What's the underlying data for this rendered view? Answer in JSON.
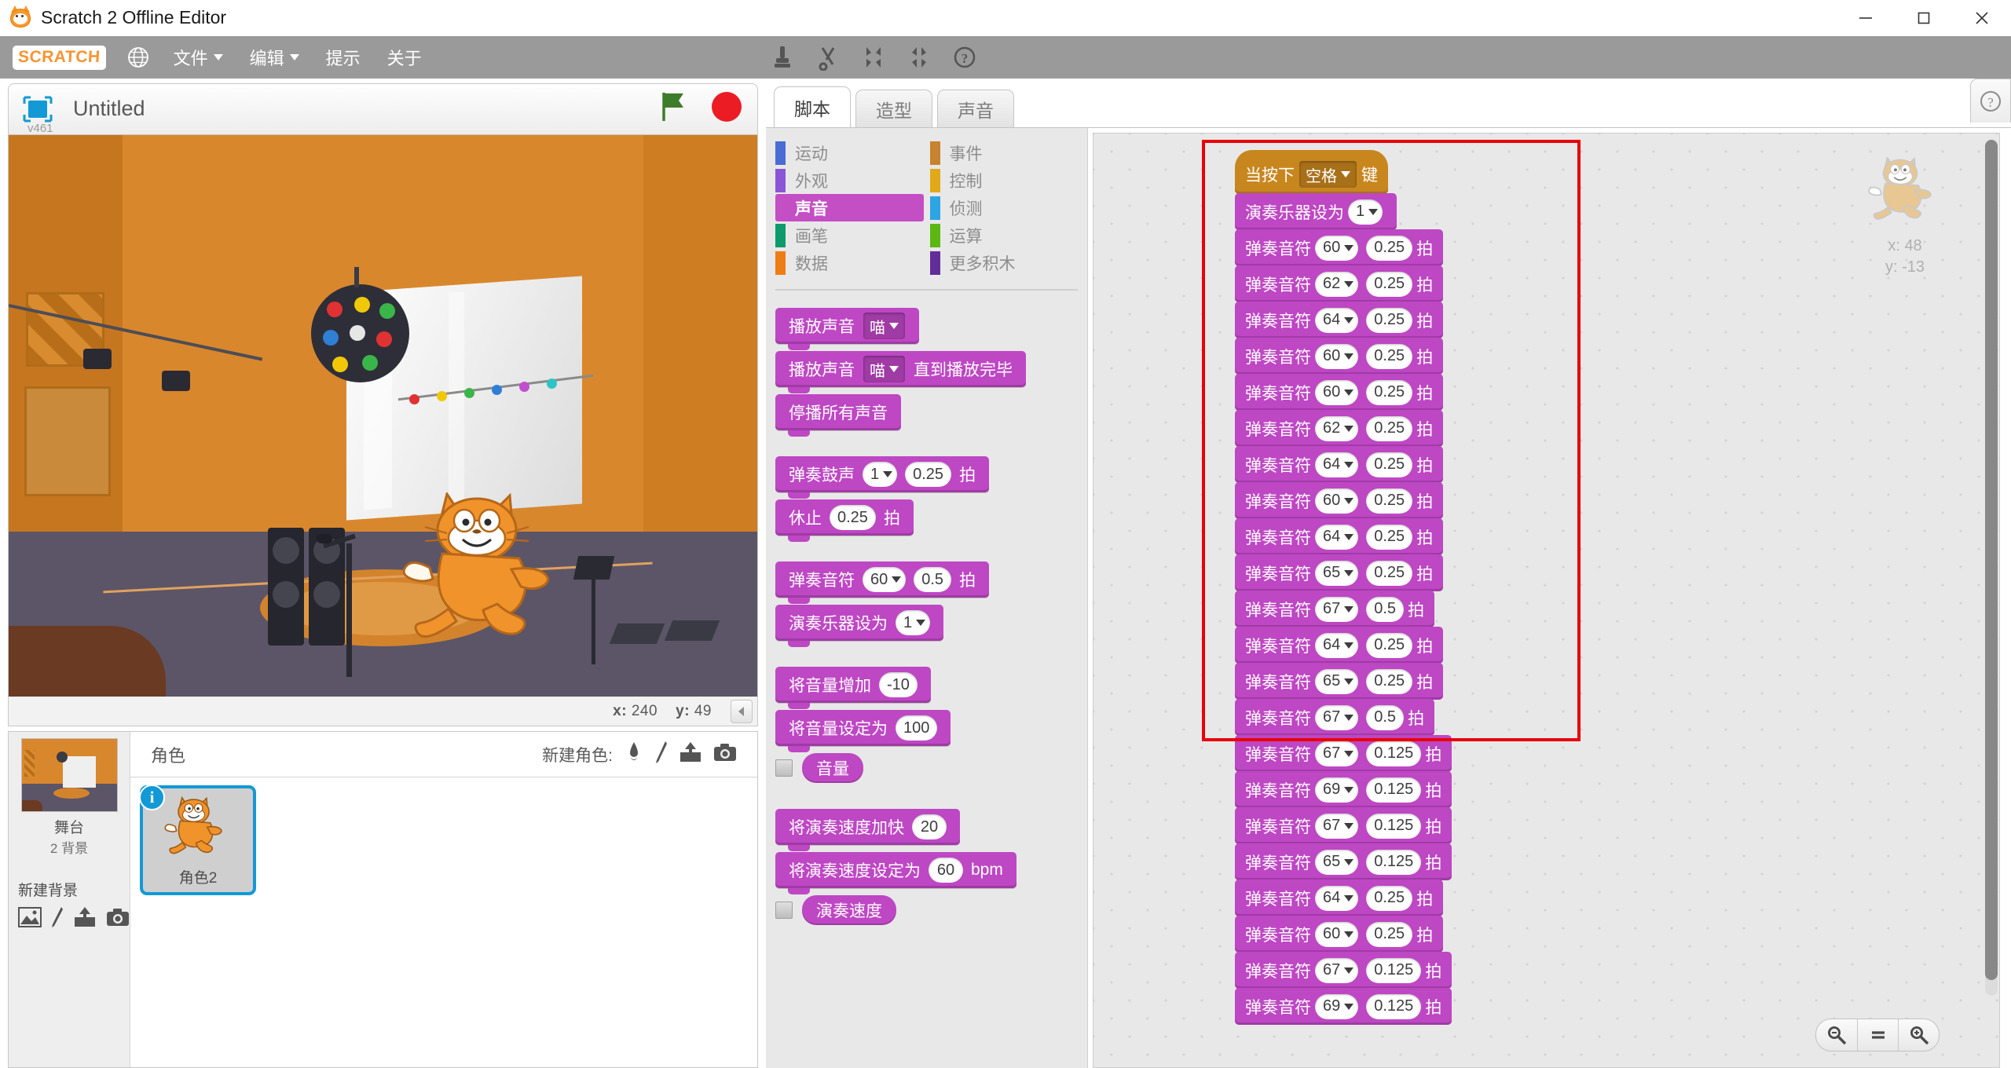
{
  "window": {
    "title": "Scratch 2 Offline Editor",
    "icon": "scratch-cat-icon",
    "minimize": "minimize-icon",
    "maximize": "maximize-icon",
    "close": "close-icon"
  },
  "menubar": {
    "logo": "SCRATCH",
    "globe_icon": "globe-icon",
    "items": [
      {
        "label": "文件",
        "has_caret": true
      },
      {
        "label": "编辑",
        "has_caret": true
      },
      {
        "label": "提示",
        "has_caret": false
      },
      {
        "label": "关于",
        "has_caret": false
      }
    ],
    "tools": [
      {
        "name": "stamp-tool-icon"
      },
      {
        "name": "scissors-tool-icon"
      },
      {
        "name": "grow-tool-icon"
      },
      {
        "name": "shrink-tool-icon"
      },
      {
        "name": "help-tool-icon"
      }
    ]
  },
  "stage": {
    "project_title": "Untitled",
    "version": "v461",
    "present_icon": "fullscreen-icon",
    "green_flag": "green-flag-icon",
    "stop_button": "stop-icon",
    "mouse_x_label": "x:",
    "mouse_x": "240",
    "mouse_y_label": "y:",
    "mouse_y": "49",
    "collapse_icon": "collapse-left-icon"
  },
  "stage_panel": {
    "thumb_label": "舞台",
    "backdrop_count": "2 背景",
    "new_backdrop_label": "新建背景",
    "new_backdrop_icons": [
      "library-icon",
      "paint-icon",
      "upload-icon",
      "camera-icon"
    ]
  },
  "sprite_panel": {
    "header": "角色",
    "new_sprite_label": "新建角色:",
    "new_sprite_icons": [
      "library-icon",
      "paint-icon",
      "upload-icon",
      "camera-icon"
    ],
    "sprites": [
      {
        "name": "角色2",
        "selected": true,
        "info_badge": "i"
      }
    ]
  },
  "tabs": [
    {
      "label": "脚本",
      "active": true
    },
    {
      "label": "造型",
      "active": false
    },
    {
      "label": "声音",
      "active": false
    }
  ],
  "palette": {
    "categories": [
      {
        "label": "运动",
        "color": "#4a6cd4",
        "selected": false
      },
      {
        "label": "事件",
        "color": "#c88330",
        "selected": false
      },
      {
        "label": "外观",
        "color": "#8a55d7",
        "selected": false
      },
      {
        "label": "控制",
        "color": "#e1a91a",
        "selected": false
      },
      {
        "label": "声音",
        "color": "#bb42c3",
        "selected": true
      },
      {
        "label": "侦测",
        "color": "#2ca5e2",
        "selected": false
      },
      {
        "label": "画笔",
        "color": "#0e9a6c",
        "selected": false
      },
      {
        "label": "运算",
        "color": "#5cb712",
        "selected": false
      },
      {
        "label": "数据",
        "color": "#ee7d16",
        "selected": false
      },
      {
        "label": "更多积木",
        "color": "#632d99",
        "selected": false
      }
    ],
    "blocks": [
      {
        "id": "play-sound",
        "parts": [
          {
            "t": "label",
            "v": "播放声音"
          },
          {
            "t": "inset-drop",
            "v": "喵"
          }
        ]
      },
      {
        "id": "play-sound-until-done",
        "parts": [
          {
            "t": "label",
            "v": "播放声音"
          },
          {
            "t": "inset-drop",
            "v": "喵"
          },
          {
            "t": "label",
            "v": "直到播放完毕"
          }
        ]
      },
      {
        "id": "stop-all-sounds",
        "parts": [
          {
            "t": "label",
            "v": "停播所有声音"
          }
        ]
      },
      {
        "id": "gap"
      },
      {
        "id": "play-drum",
        "parts": [
          {
            "t": "label",
            "v": "弹奏鼓声"
          },
          {
            "t": "oval-drop",
            "v": "1"
          },
          {
            "t": "oval",
            "v": "0.25"
          },
          {
            "t": "label",
            "v": "拍"
          }
        ]
      },
      {
        "id": "rest-for",
        "parts": [
          {
            "t": "label",
            "v": "休止"
          },
          {
            "t": "oval",
            "v": "0.25"
          },
          {
            "t": "label",
            "v": "拍"
          }
        ]
      },
      {
        "id": "gap"
      },
      {
        "id": "play-note",
        "parts": [
          {
            "t": "label",
            "v": "弹奏音符"
          },
          {
            "t": "oval-drop",
            "v": "60"
          },
          {
            "t": "oval",
            "v": "0.5"
          },
          {
            "t": "label",
            "v": "拍"
          }
        ]
      },
      {
        "id": "set-instrument",
        "parts": [
          {
            "t": "label",
            "v": "演奏乐器设为"
          },
          {
            "t": "oval-drop",
            "v": "1"
          }
        ]
      },
      {
        "id": "gap"
      },
      {
        "id": "change-volume",
        "parts": [
          {
            "t": "label",
            "v": "将音量增加"
          },
          {
            "t": "oval",
            "v": "-10"
          }
        ]
      },
      {
        "id": "set-volume",
        "parts": [
          {
            "t": "label",
            "v": "将音量设定为"
          },
          {
            "t": "oval",
            "v": "100"
          }
        ]
      },
      {
        "id": "volume-reporter",
        "reporter": true,
        "checkbox": true,
        "parts": [
          {
            "t": "label",
            "v": "音量"
          }
        ]
      },
      {
        "id": "gap"
      },
      {
        "id": "change-tempo",
        "parts": [
          {
            "t": "label",
            "v": "将演奏速度加快"
          },
          {
            "t": "oval",
            "v": "20"
          }
        ]
      },
      {
        "id": "set-tempo",
        "parts": [
          {
            "t": "label",
            "v": "将演奏速度设定为"
          },
          {
            "t": "oval",
            "v": "60"
          },
          {
            "t": "label",
            "v": "bpm"
          }
        ]
      },
      {
        "id": "tempo-reporter",
        "reporter": true,
        "checkbox": true,
        "parts": [
          {
            "t": "label",
            "v": "演奏速度"
          }
        ]
      }
    ]
  },
  "script": {
    "sprite_watermark": {
      "x_label": "x:",
      "x": "48",
      "y_label": "y:",
      "y": "-13"
    },
    "highlight_color": "#e8000a",
    "zoom_controls": [
      "zoom-out-icon",
      "zoom-reset-icon",
      "zoom-in-icon"
    ],
    "help_icon": "help-icon",
    "blocks": [
      {
        "kind": "hat",
        "parts": [
          {
            "t": "label",
            "v": "当按下"
          },
          {
            "t": "inset-drop",
            "v": "空格"
          },
          {
            "t": "label",
            "v": "键"
          }
        ]
      },
      {
        "kind": "stack",
        "parts": [
          {
            "t": "label",
            "v": "演奏乐器设为"
          },
          {
            "t": "oval-drop",
            "v": "1"
          }
        ]
      },
      {
        "kind": "stack",
        "parts": [
          {
            "t": "label",
            "v": "弹奏音符"
          },
          {
            "t": "oval-drop",
            "v": "60"
          },
          {
            "t": "oval",
            "v": "0.25"
          },
          {
            "t": "label",
            "v": "拍"
          }
        ]
      },
      {
        "kind": "stack",
        "parts": [
          {
            "t": "label",
            "v": "弹奏音符"
          },
          {
            "t": "oval-drop",
            "v": "62"
          },
          {
            "t": "oval",
            "v": "0.25"
          },
          {
            "t": "label",
            "v": "拍"
          }
        ]
      },
      {
        "kind": "stack",
        "parts": [
          {
            "t": "label",
            "v": "弹奏音符"
          },
          {
            "t": "oval-drop",
            "v": "64"
          },
          {
            "t": "oval",
            "v": "0.25"
          },
          {
            "t": "label",
            "v": "拍"
          }
        ]
      },
      {
        "kind": "stack",
        "parts": [
          {
            "t": "label",
            "v": "弹奏音符"
          },
          {
            "t": "oval-drop",
            "v": "60"
          },
          {
            "t": "oval",
            "v": "0.25"
          },
          {
            "t": "label",
            "v": "拍"
          }
        ]
      },
      {
        "kind": "stack",
        "parts": [
          {
            "t": "label",
            "v": "弹奏音符"
          },
          {
            "t": "oval-drop",
            "v": "60"
          },
          {
            "t": "oval",
            "v": "0.25"
          },
          {
            "t": "label",
            "v": "拍"
          }
        ]
      },
      {
        "kind": "stack",
        "parts": [
          {
            "t": "label",
            "v": "弹奏音符"
          },
          {
            "t": "oval-drop",
            "v": "62"
          },
          {
            "t": "oval",
            "v": "0.25"
          },
          {
            "t": "label",
            "v": "拍"
          }
        ]
      },
      {
        "kind": "stack",
        "parts": [
          {
            "t": "label",
            "v": "弹奏音符"
          },
          {
            "t": "oval-drop",
            "v": "64"
          },
          {
            "t": "oval",
            "v": "0.25"
          },
          {
            "t": "label",
            "v": "拍"
          }
        ]
      },
      {
        "kind": "stack",
        "parts": [
          {
            "t": "label",
            "v": "弹奏音符"
          },
          {
            "t": "oval-drop",
            "v": "60"
          },
          {
            "t": "oval",
            "v": "0.25"
          },
          {
            "t": "label",
            "v": "拍"
          }
        ]
      },
      {
        "kind": "stack",
        "parts": [
          {
            "t": "label",
            "v": "弹奏音符"
          },
          {
            "t": "oval-drop",
            "v": "64"
          },
          {
            "t": "oval",
            "v": "0.25"
          },
          {
            "t": "label",
            "v": "拍"
          }
        ]
      },
      {
        "kind": "stack",
        "parts": [
          {
            "t": "label",
            "v": "弹奏音符"
          },
          {
            "t": "oval-drop",
            "v": "65"
          },
          {
            "t": "oval",
            "v": "0.25"
          },
          {
            "t": "label",
            "v": "拍"
          }
        ]
      },
      {
        "kind": "stack",
        "parts": [
          {
            "t": "label",
            "v": "弹奏音符"
          },
          {
            "t": "oval-drop",
            "v": "67"
          },
          {
            "t": "oval",
            "v": "0.5"
          },
          {
            "t": "label",
            "v": "拍"
          }
        ]
      },
      {
        "kind": "stack",
        "parts": [
          {
            "t": "label",
            "v": "弹奏音符"
          },
          {
            "t": "oval-drop",
            "v": "64"
          },
          {
            "t": "oval",
            "v": "0.25"
          },
          {
            "t": "label",
            "v": "拍"
          }
        ]
      },
      {
        "kind": "stack",
        "parts": [
          {
            "t": "label",
            "v": "弹奏音符"
          },
          {
            "t": "oval-drop",
            "v": "65"
          },
          {
            "t": "oval",
            "v": "0.25"
          },
          {
            "t": "label",
            "v": "拍"
          }
        ]
      },
      {
        "kind": "stack",
        "parts": [
          {
            "t": "label",
            "v": "弹奏音符"
          },
          {
            "t": "oval-drop",
            "v": "67"
          },
          {
            "t": "oval",
            "v": "0.5"
          },
          {
            "t": "label",
            "v": "拍"
          }
        ]
      },
      {
        "kind": "stack",
        "parts": [
          {
            "t": "label",
            "v": "弹奏音符"
          },
          {
            "t": "oval-drop",
            "v": "67"
          },
          {
            "t": "oval",
            "v": "0.125"
          },
          {
            "t": "label",
            "v": "拍"
          }
        ]
      },
      {
        "kind": "stack",
        "parts": [
          {
            "t": "label",
            "v": "弹奏音符"
          },
          {
            "t": "oval-drop",
            "v": "69"
          },
          {
            "t": "oval",
            "v": "0.125"
          },
          {
            "t": "label",
            "v": "拍"
          }
        ]
      },
      {
        "kind": "stack",
        "parts": [
          {
            "t": "label",
            "v": "弹奏音符"
          },
          {
            "t": "oval-drop",
            "v": "67"
          },
          {
            "t": "oval",
            "v": "0.125"
          },
          {
            "t": "label",
            "v": "拍"
          }
        ]
      },
      {
        "kind": "stack",
        "parts": [
          {
            "t": "label",
            "v": "弹奏音符"
          },
          {
            "t": "oval-drop",
            "v": "65"
          },
          {
            "t": "oval",
            "v": "0.125"
          },
          {
            "t": "label",
            "v": "拍"
          }
        ]
      },
      {
        "kind": "stack",
        "parts": [
          {
            "t": "label",
            "v": "弹奏音符"
          },
          {
            "t": "oval-drop",
            "v": "64"
          },
          {
            "t": "oval",
            "v": "0.25"
          },
          {
            "t": "label",
            "v": "拍"
          }
        ]
      },
      {
        "kind": "stack",
        "parts": [
          {
            "t": "label",
            "v": "弹奏音符"
          },
          {
            "t": "oval-drop",
            "v": "60"
          },
          {
            "t": "oval",
            "v": "0.25"
          },
          {
            "t": "label",
            "v": "拍"
          }
        ]
      },
      {
        "kind": "stack",
        "parts": [
          {
            "t": "label",
            "v": "弹奏音符"
          },
          {
            "t": "oval-drop",
            "v": "67"
          },
          {
            "t": "oval",
            "v": "0.125"
          },
          {
            "t": "label",
            "v": "拍"
          }
        ]
      },
      {
        "kind": "stack",
        "parts": [
          {
            "t": "label",
            "v": "弹奏音符"
          },
          {
            "t": "oval-drop",
            "v": "69"
          },
          {
            "t": "oval",
            "v": "0.125"
          },
          {
            "t": "label",
            "v": "拍"
          }
        ]
      }
    ],
    "highlight_from_index": 0,
    "highlight_to_index": 15
  }
}
